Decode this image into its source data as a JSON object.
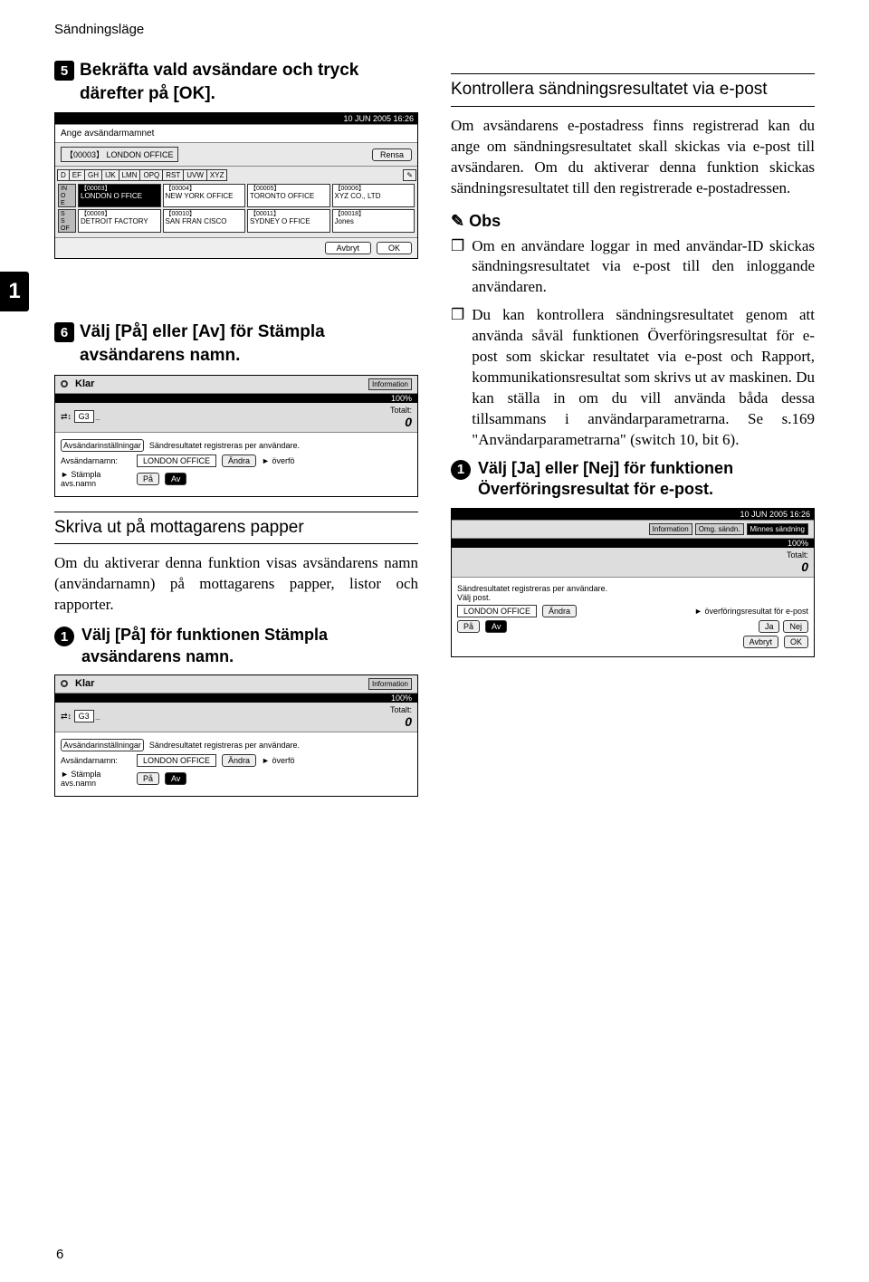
{
  "header": "Sändningsläge",
  "page_number": "6",
  "left": {
    "step5": "Bekräfta vald avsändare och tryck därefter på ",
    "step5_key": "[OK]",
    "step5_end": ".",
    "step6": "Välj ",
    "step6_key1": "[På]",
    "step6_mid": " eller ",
    "step6_key2": "[Av]",
    "step6_rest": " för Stämpla avsändarens namn.",
    "subhead": "Skriva ut på mottagarens papper",
    "para": "Om du aktiverar denna funktion visas avsändarens namn (användarnamn) på mottagarens papper, listor och rapporter.",
    "bullet1_a": "Välj ",
    "bullet1_key": "[På]",
    "bullet1_b": " för funktionen Stämpla avsändarens namn."
  },
  "right": {
    "subhead": "Kontrollera sändningsresultatet via e-post",
    "para": "Om avsändarens e-postadress finns registrerad kan du ange om sändningsresultatet skall skickas via e-post till avsändaren. Om du aktiverar denna funktion skickas sändningsresultatet till den registrerade e-postadressen.",
    "obs": "Obs",
    "note1": "Om en användare loggar in med användar-ID skickas sändningsresultatet via e-post till den inloggande användaren.",
    "note2": "Du kan kontrollera sändningsresultatet genom att använda såväl funktionen Överföringsresultat för e-post som skickar resultatet via e-post och Rapport, kommunikationsresultat som skrivs ut av maskinen. Du kan ställa in om du vill använda båda dessa tillsammans i användarparametrarna. Se s.169 \"Användarparametrarna\" (switch 10, bit 6).",
    "bullet1_a": "Välj ",
    "bullet1_key1": "[Ja]",
    "bullet1_mid": " eller ",
    "bullet1_key2": "[Nej]",
    "bullet1_b": " för funktionen Överföringsresultat för e-post."
  },
  "screenshots": {
    "timecode": "10 JUN 2005 16:26",
    "directory": {
      "prompt": "Ange avsändarmamnet",
      "selected": "【00003】 LONDON OFFICE",
      "clear": "Rensa",
      "tabs": [
        "D",
        "EF",
        "GH",
        "IJK",
        "LMN",
        "OPQ",
        "RST",
        "UVW",
        "XYZ"
      ],
      "switch": "✎",
      "rows": [
        [
          {
            "id": "【00003】",
            "name": "LONDON O FFICE",
            "sel": true
          },
          {
            "id": "【00004】",
            "name": "NEW YORK OFFICE"
          },
          {
            "id": "【00005】",
            "name": "TORONTO OFFICE"
          },
          {
            "id": "【00006】",
            "name": "XYZ CO., LTD"
          },
          {
            "id": "",
            "name": ""
          }
        ],
        [
          {
            "id": "【00009】",
            "name": "DETROIT FACTORY"
          },
          {
            "id": "【00010】",
            "name": "SAN FRAN CISCO"
          },
          {
            "id": "【00011】",
            "name": "SYDNEY O FFICE"
          },
          {
            "id": "【00018】",
            "name": "Jones"
          },
          {
            "id": "",
            "name": ""
          }
        ]
      ],
      "row_left": [
        "IN O",
        "E",
        "S",
        "S OF"
      ],
      "cancel": "Avbryt",
      "ok": "OK"
    },
    "settings": {
      "status": "Klar",
      "info": "Information",
      "percent": "100%",
      "g3": "G3",
      "total_label": "Totalt:",
      "total_value": "0",
      "leftlabel": "Avsändarinställningar",
      "msg": "Sändresultatet registreras per användare.",
      "name_label": "Avsändarnamn:",
      "name_value": "LONDON OFFICE",
      "change": "Ändra",
      "overfo": "överfö",
      "stamp_label": "Stämpla avs.namn",
      "on": "På",
      "off": "Av",
      "welj": "Välj post.",
      "badges": [
        "Information",
        "Omg. sändn.",
        "Minnes sändning"
      ],
      "overf_full": "överföringsresultat för e-post",
      "yes": "Ja",
      "no": "Nej",
      "cancel": "Avbryt",
      "ok": "OK",
      "arrow_icons": "⇄↕"
    }
  }
}
